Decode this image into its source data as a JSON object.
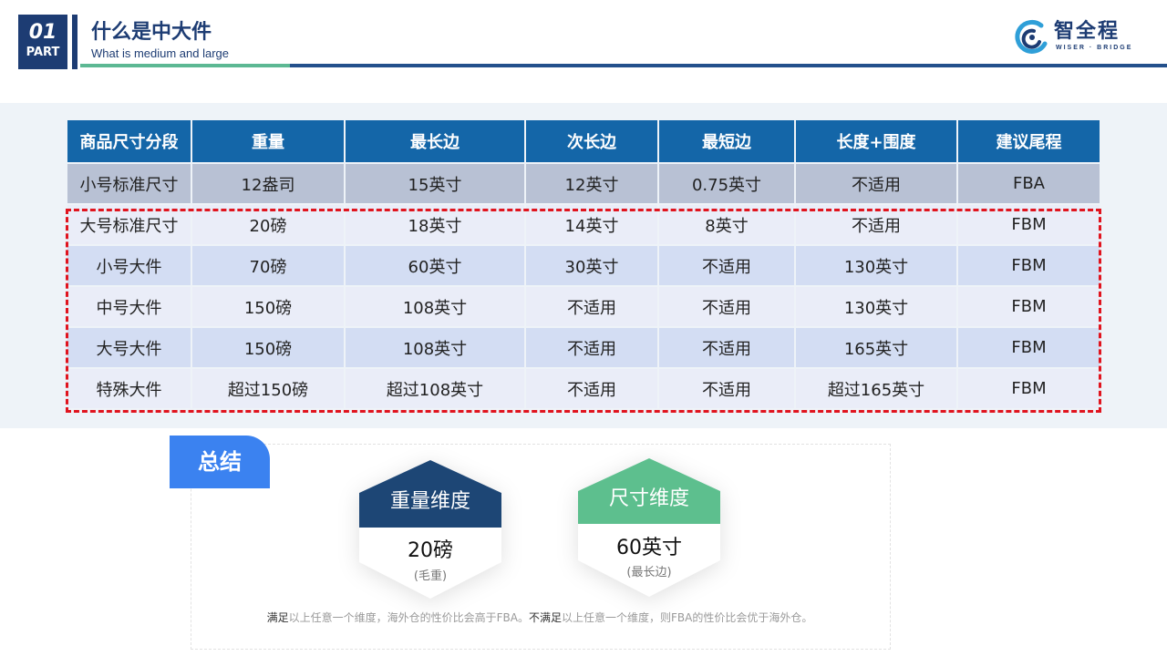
{
  "header": {
    "part_number": "01",
    "part_label": "PART",
    "title": "什么是中大件",
    "subtitle": "What is medium and large",
    "logo_text": "智全程",
    "logo_sub": "WISER · BRIDGE"
  },
  "table": {
    "headers": [
      "商品尺寸分段",
      "重量",
      "最长边",
      "次长边",
      "最短边",
      "长度+围度",
      "建议尾程"
    ],
    "rows": [
      [
        "小号标准尺寸",
        "12盎司",
        "15英寸",
        "12英寸",
        "0.75英寸",
        "不适用",
        "FBA"
      ],
      [
        "大号标准尺寸",
        "20磅",
        "18英寸",
        "14英寸",
        "8英寸",
        "不适用",
        "FBM"
      ],
      [
        "小号大件",
        "70磅",
        "60英寸",
        "30英寸",
        "不适用",
        "130英寸",
        "FBM"
      ],
      [
        "中号大件",
        "150磅",
        "108英寸",
        "不适用",
        "不适用",
        "130英寸",
        "FBM"
      ],
      [
        "大号大件",
        "150磅",
        "108英寸",
        "不适用",
        "不适用",
        "165英寸",
        "FBM"
      ],
      [
        "特殊大件",
        "超过150磅",
        "超过108英寸",
        "不适用",
        "不适用",
        "超过165英寸",
        "FBM"
      ]
    ]
  },
  "summary": {
    "tag": "总结",
    "weight": {
      "title": "重量维度",
      "value": "20磅",
      "note": "(毛重)",
      "color": "#1d4675"
    },
    "size": {
      "title": "尺寸维度",
      "value": "60英寸",
      "note": "(最长边)",
      "color": "#5dbf8e"
    },
    "note_parts": [
      "满足",
      "以上任意一个维度，海外仓的性价比会高于FBA。",
      "不满足",
      "以上任意一个维度，则FBA的性价比会优于海外仓。"
    ]
  },
  "colors": {
    "brand_navy": "#1d3c73",
    "header_blue": "#1466a8",
    "accent_green": "#5cb893",
    "highlight_red": "#e0141e",
    "tag_blue": "#3b82f0"
  }
}
